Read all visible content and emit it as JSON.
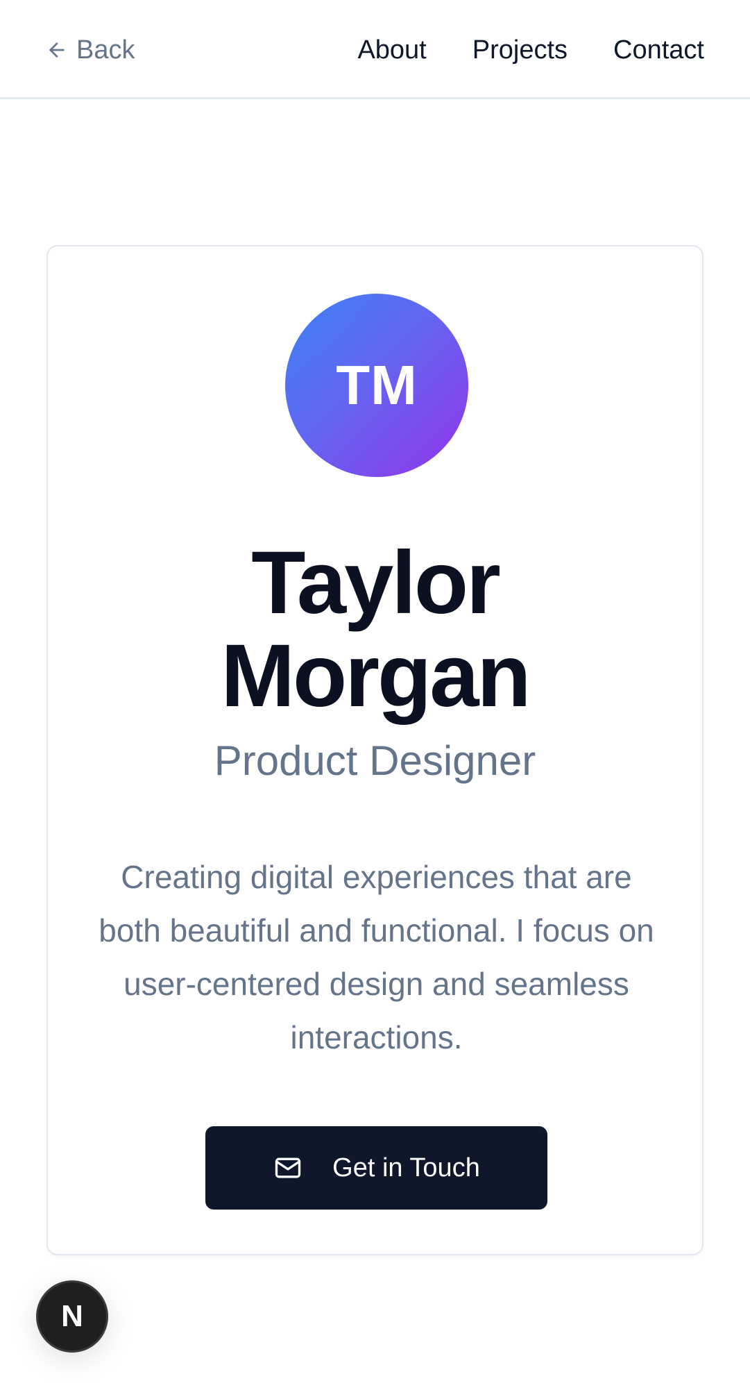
{
  "header": {
    "back_label": "Back",
    "nav": [
      {
        "label": "About"
      },
      {
        "label": "Projects"
      },
      {
        "label": "Contact"
      }
    ]
  },
  "profile": {
    "initials": "TM",
    "first_name": "Taylor",
    "last_name": "Morgan",
    "role": "Product Designer",
    "bio": "Creating digital experiences that are both beautiful and functional. I focus on user-centered design and seamless interactions.",
    "cta_label": "Get in Touch"
  },
  "badge": {
    "letter": "N"
  },
  "colors": {
    "accent_gradient_start": "#3b82f6",
    "accent_gradient_end": "#9333ea",
    "button_bg": "#0f172a",
    "muted_text": "#64748b"
  },
  "icons": {
    "back": "arrow-left-icon",
    "cta": "mail-icon",
    "badge": "nextjs-logo-icon"
  }
}
